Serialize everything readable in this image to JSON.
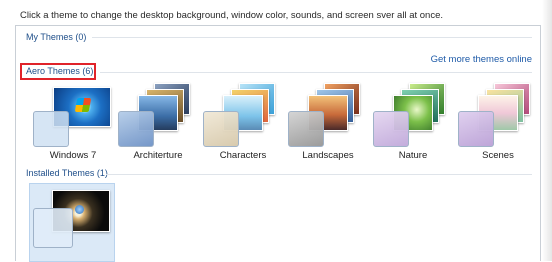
{
  "instruction": "Click a theme to change the desktop background, window color, sounds, and screen sver all at once.",
  "groups": {
    "my_themes": "My Themes (0)",
    "aero_themes": "Aero Themes (6)",
    "installed_themes": "Installed Themes (1)"
  },
  "get_more_link": "Get more themes online",
  "aero_themes": [
    {
      "name": "Windows 7",
      "glass_color": "#cfe0f2"
    },
    {
      "name": "Architerture",
      "glass_color": "#9fb8d8"
    },
    {
      "name": "Characters",
      "glass_color": "#e6dcc6"
    },
    {
      "name": "Landscapes",
      "glass_color": "#b8b8b8"
    },
    {
      "name": "Nature",
      "glass_color": "#d4c3e4"
    },
    {
      "name": "Scenes",
      "glass_color": "#cdbce0"
    }
  ],
  "colors": {
    "header_text": "#1f4f8a",
    "link_text": "#1f5ba8",
    "highlight_border": "#e0232a",
    "selected_tile": "#dbe9f7"
  }
}
